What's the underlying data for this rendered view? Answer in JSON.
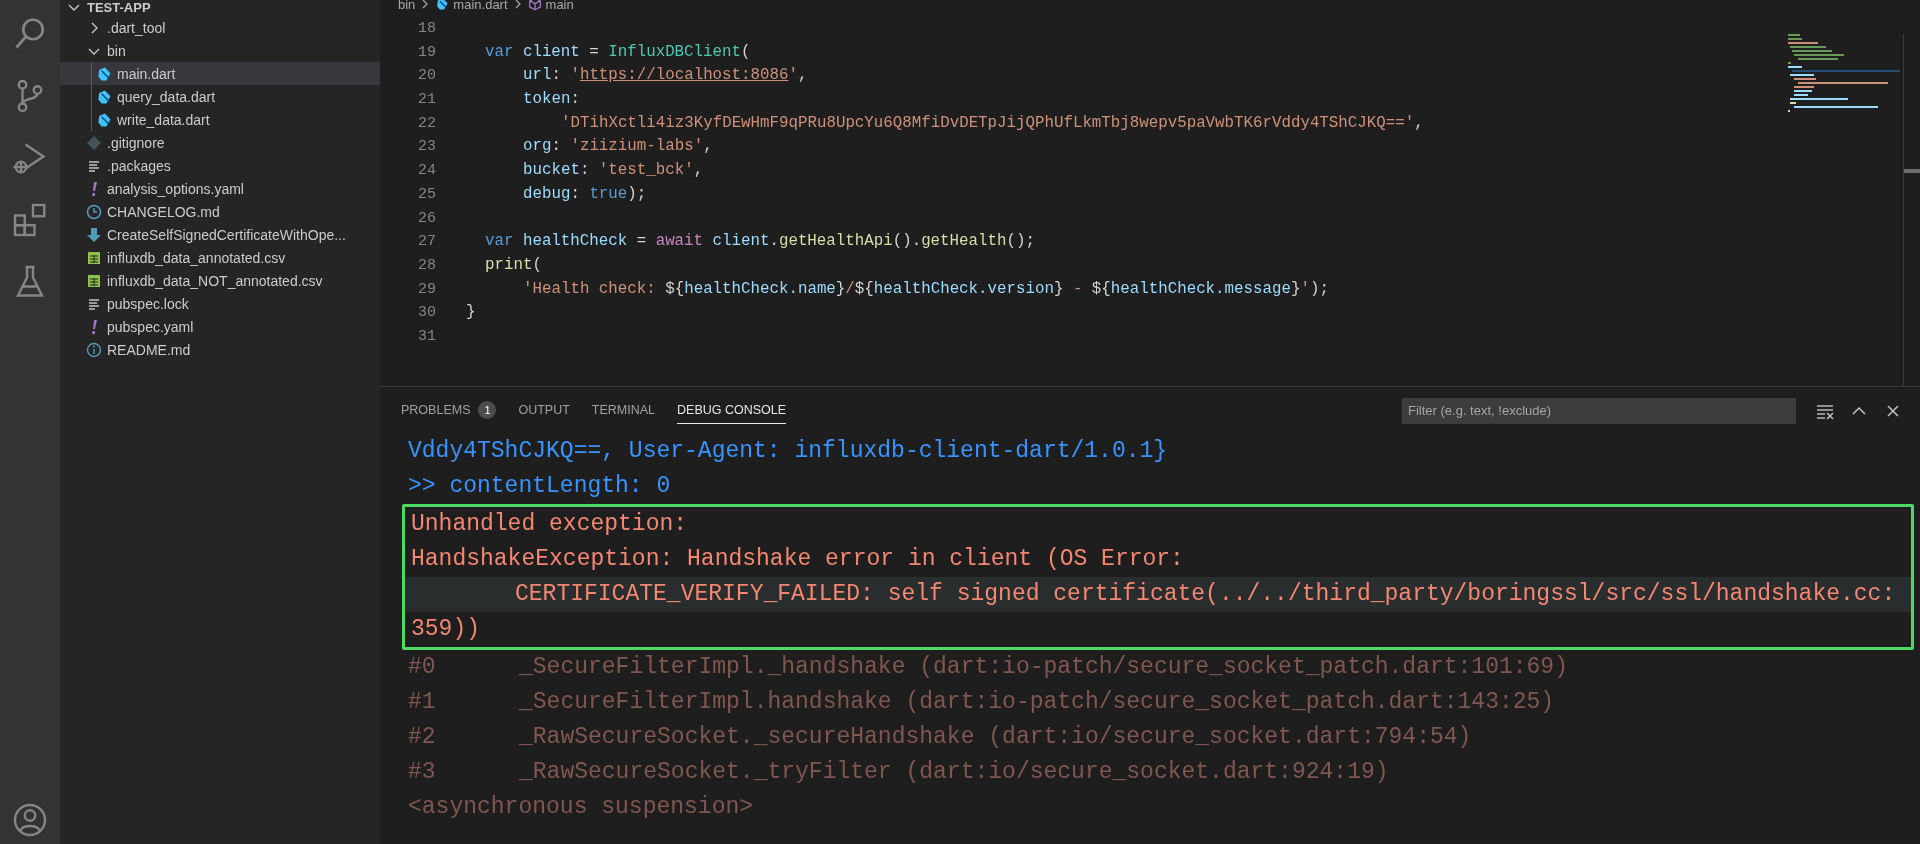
{
  "activity_bar": {
    "items": [
      {
        "kind": "search",
        "selected": false
      },
      {
        "kind": "source-control",
        "selected": false
      },
      {
        "kind": "run-debug",
        "selected": false
      },
      {
        "kind": "extensions",
        "selected": false
      },
      {
        "kind": "testing",
        "selected": false
      }
    ],
    "bottom": [
      {
        "kind": "account",
        "selected": false
      }
    ]
  },
  "explorer": {
    "root": {
      "label": "TEST-APP",
      "expanded": true,
      "children": [
        {
          "label": ".dart_tool",
          "kind": "folder",
          "expanded": false
        },
        {
          "label": "bin",
          "kind": "folder",
          "expanded": true,
          "children": [
            {
              "label": "main.dart",
              "kind": "dart",
              "selected": true
            },
            {
              "label": "query_data.dart",
              "kind": "dart",
              "selected": false
            },
            {
              "label": "write_data.dart",
              "kind": "dart",
              "selected": false
            }
          ]
        },
        {
          "label": ".gitignore",
          "kind": "git",
          "selected": false
        },
        {
          "label": ".packages",
          "kind": "text",
          "selected": false
        },
        {
          "label": "analysis_options.yaml",
          "kind": "yaml",
          "selected": false
        },
        {
          "label": "CHANGELOG.md",
          "kind": "changelog",
          "selected": false
        },
        {
          "label": "CreateSelfSignedCertificateWithOpe...",
          "kind": "download",
          "selected": false
        },
        {
          "label": "influxdb_data_annotated.csv",
          "kind": "csv",
          "selected": false
        },
        {
          "label": "influxdb_data_NOT_annotated.csv",
          "kind": "csv",
          "selected": false
        },
        {
          "label": "pubspec.lock",
          "kind": "text",
          "selected": false
        },
        {
          "label": "pubspec.yaml",
          "kind": "yaml",
          "selected": false
        },
        {
          "label": "README.md",
          "kind": "info",
          "selected": false
        }
      ]
    }
  },
  "breadcrumb": [
    {
      "label": "bin",
      "kind": "folder"
    },
    {
      "label": "main.dart",
      "kind": "dart"
    },
    {
      "label": "main",
      "kind": "symbol"
    }
  ],
  "editor": {
    "lines": [
      {
        "number": "18"
      },
      {
        "number": "19",
        "kind": "statement",
        "tokens": [
          {
            "kind": "keyword",
            "text": "var "
          },
          {
            "kind": "variable",
            "text": "client"
          },
          {
            "kind": "punct",
            "text": " = "
          },
          {
            "kind": "class",
            "text": "InfluxDBClient"
          },
          {
            "kind": "punct",
            "text": "("
          }
        ]
      },
      {
        "number": "20",
        "kind": "argument",
        "tokens": [
          {
            "kind": "variable",
            "text": "url"
          },
          {
            "kind": "punct",
            "text": ": "
          },
          {
            "kind": "string",
            "text": "'"
          },
          {
            "kind": "link",
            "text": "https://localhost:8086"
          },
          {
            "kind": "string",
            "text": "'"
          },
          {
            "kind": "punct",
            "text": ","
          }
        ]
      },
      {
        "number": "21",
        "kind": "argument",
        "tokens": [
          {
            "kind": "variable",
            "text": "token"
          },
          {
            "kind": "punct",
            "text": ":"
          }
        ]
      },
      {
        "number": "22",
        "kind": "continuation",
        "tokens": [
          {
            "kind": "string",
            "text": "'DTihXctli4iz3KyfDEwHmF9qPRu8UpcYu6Q8MfiDvDETpJijQPhUfLkmTbj8wepv5paVwbTK6rVddy4TShCJKQ=='"
          },
          {
            "kind": "punct",
            "text": ","
          }
        ]
      },
      {
        "number": "23",
        "kind": "argument",
        "tokens": [
          {
            "kind": "variable",
            "text": "org"
          },
          {
            "kind": "punct",
            "text": ": "
          },
          {
            "kind": "string",
            "text": "'ziizium-labs'"
          },
          {
            "kind": "punct",
            "text": ","
          }
        ]
      },
      {
        "number": "24",
        "kind": "argument",
        "tokens": [
          {
            "kind": "variable",
            "text": "bucket"
          },
          {
            "kind": "punct",
            "text": ": "
          },
          {
            "kind": "string",
            "text": "'test_bck'"
          },
          {
            "kind": "punct",
            "text": ","
          }
        ]
      },
      {
        "number": "25",
        "kind": "argument",
        "tokens": [
          {
            "kind": "variable",
            "text": "debug"
          },
          {
            "kind": "punct",
            "text": ": "
          },
          {
            "kind": "keyword",
            "text": "true"
          },
          {
            "kind": "punct",
            "text": ");"
          }
        ]
      },
      {
        "number": "26"
      },
      {
        "number": "27",
        "kind": "statement",
        "tokens": [
          {
            "kind": "keyword",
            "text": "var "
          },
          {
            "kind": "variable",
            "text": "healthCheck"
          },
          {
            "kind": "punct",
            "text": " = "
          },
          {
            "kind": "control",
            "text": "await "
          },
          {
            "kind": "variable",
            "text": "client"
          },
          {
            "kind": "punct",
            "text": "."
          },
          {
            "kind": "function",
            "text": "getHealthApi"
          },
          {
            "kind": "punct",
            "text": "()."
          },
          {
            "kind": "function",
            "text": "getHealth"
          },
          {
            "kind": "punct",
            "text": "();"
          }
        ]
      },
      {
        "number": "28",
        "kind": "statement",
        "tokens": [
          {
            "kind": "function",
            "text": "print"
          },
          {
            "kind": "punct",
            "text": "("
          }
        ]
      },
      {
        "number": "29",
        "kind": "argument",
        "tokens": [
          {
            "kind": "string",
            "text": "'Health check: "
          },
          {
            "kind": "punct",
            "text": "${"
          },
          {
            "kind": "variable",
            "text": "healthCheck.name"
          },
          {
            "kind": "punct",
            "text": "}"
          },
          {
            "kind": "string",
            "text": "/"
          },
          {
            "kind": "punct",
            "text": "${"
          },
          {
            "kind": "variable",
            "text": "healthCheck.version"
          },
          {
            "kind": "punct",
            "text": "}"
          },
          {
            "kind": "string",
            "text": " - "
          },
          {
            "kind": "punct",
            "text": "${"
          },
          {
            "kind": "variable",
            "text": "healthCheck.message"
          },
          {
            "kind": "punct",
            "text": "}"
          },
          {
            "kind": "string",
            "text": "'"
          },
          {
            "kind": "punct",
            "text": ");"
          }
        ]
      },
      {
        "number": "30",
        "kind": "close",
        "tokens": [
          {
            "kind": "punct",
            "text": "}"
          }
        ]
      },
      {
        "number": "31"
      }
    ]
  },
  "panel": {
    "tabs": [
      {
        "label": "PROBLEMS",
        "badge": "1",
        "selected": false
      },
      {
        "label": "OUTPUT",
        "selected": false
      },
      {
        "label": "TERMINAL",
        "selected": false
      },
      {
        "label": "DEBUG CONSOLE",
        "selected": true
      }
    ],
    "filter": {
      "placeholder": "Filter (e.g. text, !exclude)"
    },
    "actions": [
      {
        "kind": "clear"
      },
      {
        "kind": "maximize"
      },
      {
        "kind": "close"
      }
    ]
  },
  "console": {
    "lines": [
      {
        "kind": "info",
        "text": "Vddy4TShCJKQ==, User-Agent: influxdb-client-dart/1.0.1}"
      },
      {
        "kind": "info",
        "text": ">> contentLength: 0"
      },
      {
        "kind": "error",
        "highlighted": true,
        "text": "Unhandled exception:"
      },
      {
        "kind": "error",
        "highlighted": true,
        "text": "HandshakeException: Handshake error in client (OS Error:"
      },
      {
        "kind": "error",
        "highlighted": true,
        "indent": true,
        "hover": true,
        "text": "CERTIFICATE_VERIFY_FAILED: self signed certificate(../../third_party/boringssl/src/ssl/handshake.cc:"
      },
      {
        "kind": "error",
        "highlighted": true,
        "text": "359))"
      },
      {
        "kind": "trace",
        "frame": "#0",
        "text": "_SecureFilterImpl._handshake (dart:io-patch/secure_socket_patch.dart:101:69)"
      },
      {
        "kind": "trace",
        "frame": "#1",
        "text": "_SecureFilterImpl.handshake (dart:io-patch/secure_socket_patch.dart:143:25)"
      },
      {
        "kind": "trace",
        "frame": "#2",
        "text": "_RawSecureSocket._secureHandshake (dart:io/secure_socket.dart:794:54)"
      },
      {
        "kind": "trace",
        "frame": "#3",
        "text": "_RawSecureSocket._tryFilter (dart:io/secure_socket.dart:924:19)"
      },
      {
        "kind": "trace",
        "text": "<asynchronous suspension>"
      }
    ]
  }
}
